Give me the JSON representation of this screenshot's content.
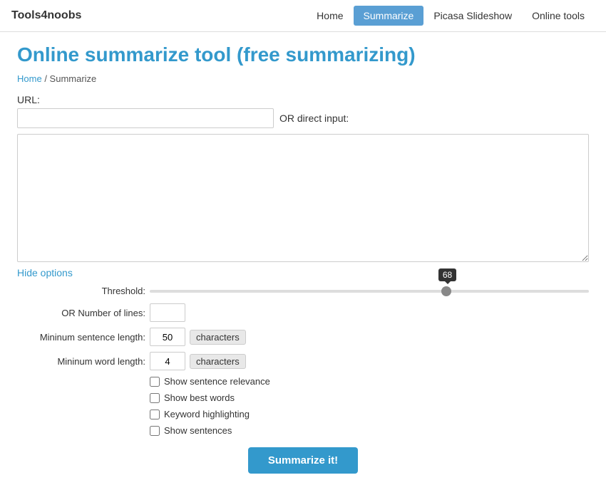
{
  "brand": "Tools4noobs",
  "nav": {
    "links": [
      {
        "label": "Home",
        "active": false
      },
      {
        "label": "Summarize",
        "active": true
      },
      {
        "label": "Picasa Slideshow",
        "active": false
      },
      {
        "label": "Online tools",
        "active": false
      }
    ]
  },
  "page": {
    "title": "Online summarize tool (free summarizing)",
    "breadcrumb_home": "Home",
    "breadcrumb_current": "Summarize"
  },
  "form": {
    "url_label": "URL:",
    "url_placeholder": "",
    "or_direct_label": "OR direct input:",
    "textarea_placeholder": "",
    "hide_options_label": "Hide options",
    "threshold_label": "Threshold:",
    "slider_value": "68",
    "number_of_lines_label": "OR Number of lines:",
    "min_sentence_label": "Mininum sentence length:",
    "min_sentence_value": "50",
    "min_word_label": "Mininum word length:",
    "min_word_value": "4",
    "characters_label": "characters",
    "show_sentence_relevance": "Show sentence relevance",
    "show_best_words": "Show best words",
    "keyword_highlighting": "Keyword highlighting",
    "show_sentences": "Show sentences",
    "submit_label": "Summarize it!"
  }
}
